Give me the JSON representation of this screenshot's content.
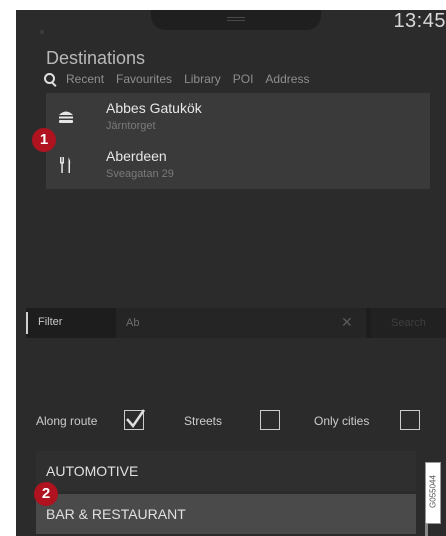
{
  "status": {
    "time": "13:45"
  },
  "header": {
    "title": "Destinations"
  },
  "tabs": [
    {
      "label": "Recent"
    },
    {
      "label": "Favourites"
    },
    {
      "label": "Library"
    },
    {
      "label": "POI"
    },
    {
      "label": "Address"
    }
  ],
  "results": [
    {
      "name": "Abbes Gatukök",
      "address": "Järntorget",
      "icon": "burger-icon"
    },
    {
      "name": "Aberdeen",
      "address": "Sveagatan 29",
      "icon": "restaurant-icon"
    }
  ],
  "filter": {
    "label": "Filter",
    "query": "Ab",
    "search_label": "Search"
  },
  "options": {
    "along_route": {
      "label": "Along route",
      "checked": true
    },
    "streets": {
      "label": "Streets",
      "checked": false
    },
    "only_cities": {
      "label": "Only cities",
      "checked": false
    }
  },
  "categories": [
    {
      "label": "AUTOMOTIVE"
    },
    {
      "label": "BAR & RESTAURANT"
    }
  ],
  "callouts": [
    {
      "number": "1"
    },
    {
      "number": "2"
    }
  ],
  "figure_code": "G055044",
  "colors": {
    "screen_bg": "#2b2b2b",
    "panel_bg": "#3a3a3a",
    "callout": "#b0121f",
    "selected_row": "#4a4a4a"
  }
}
